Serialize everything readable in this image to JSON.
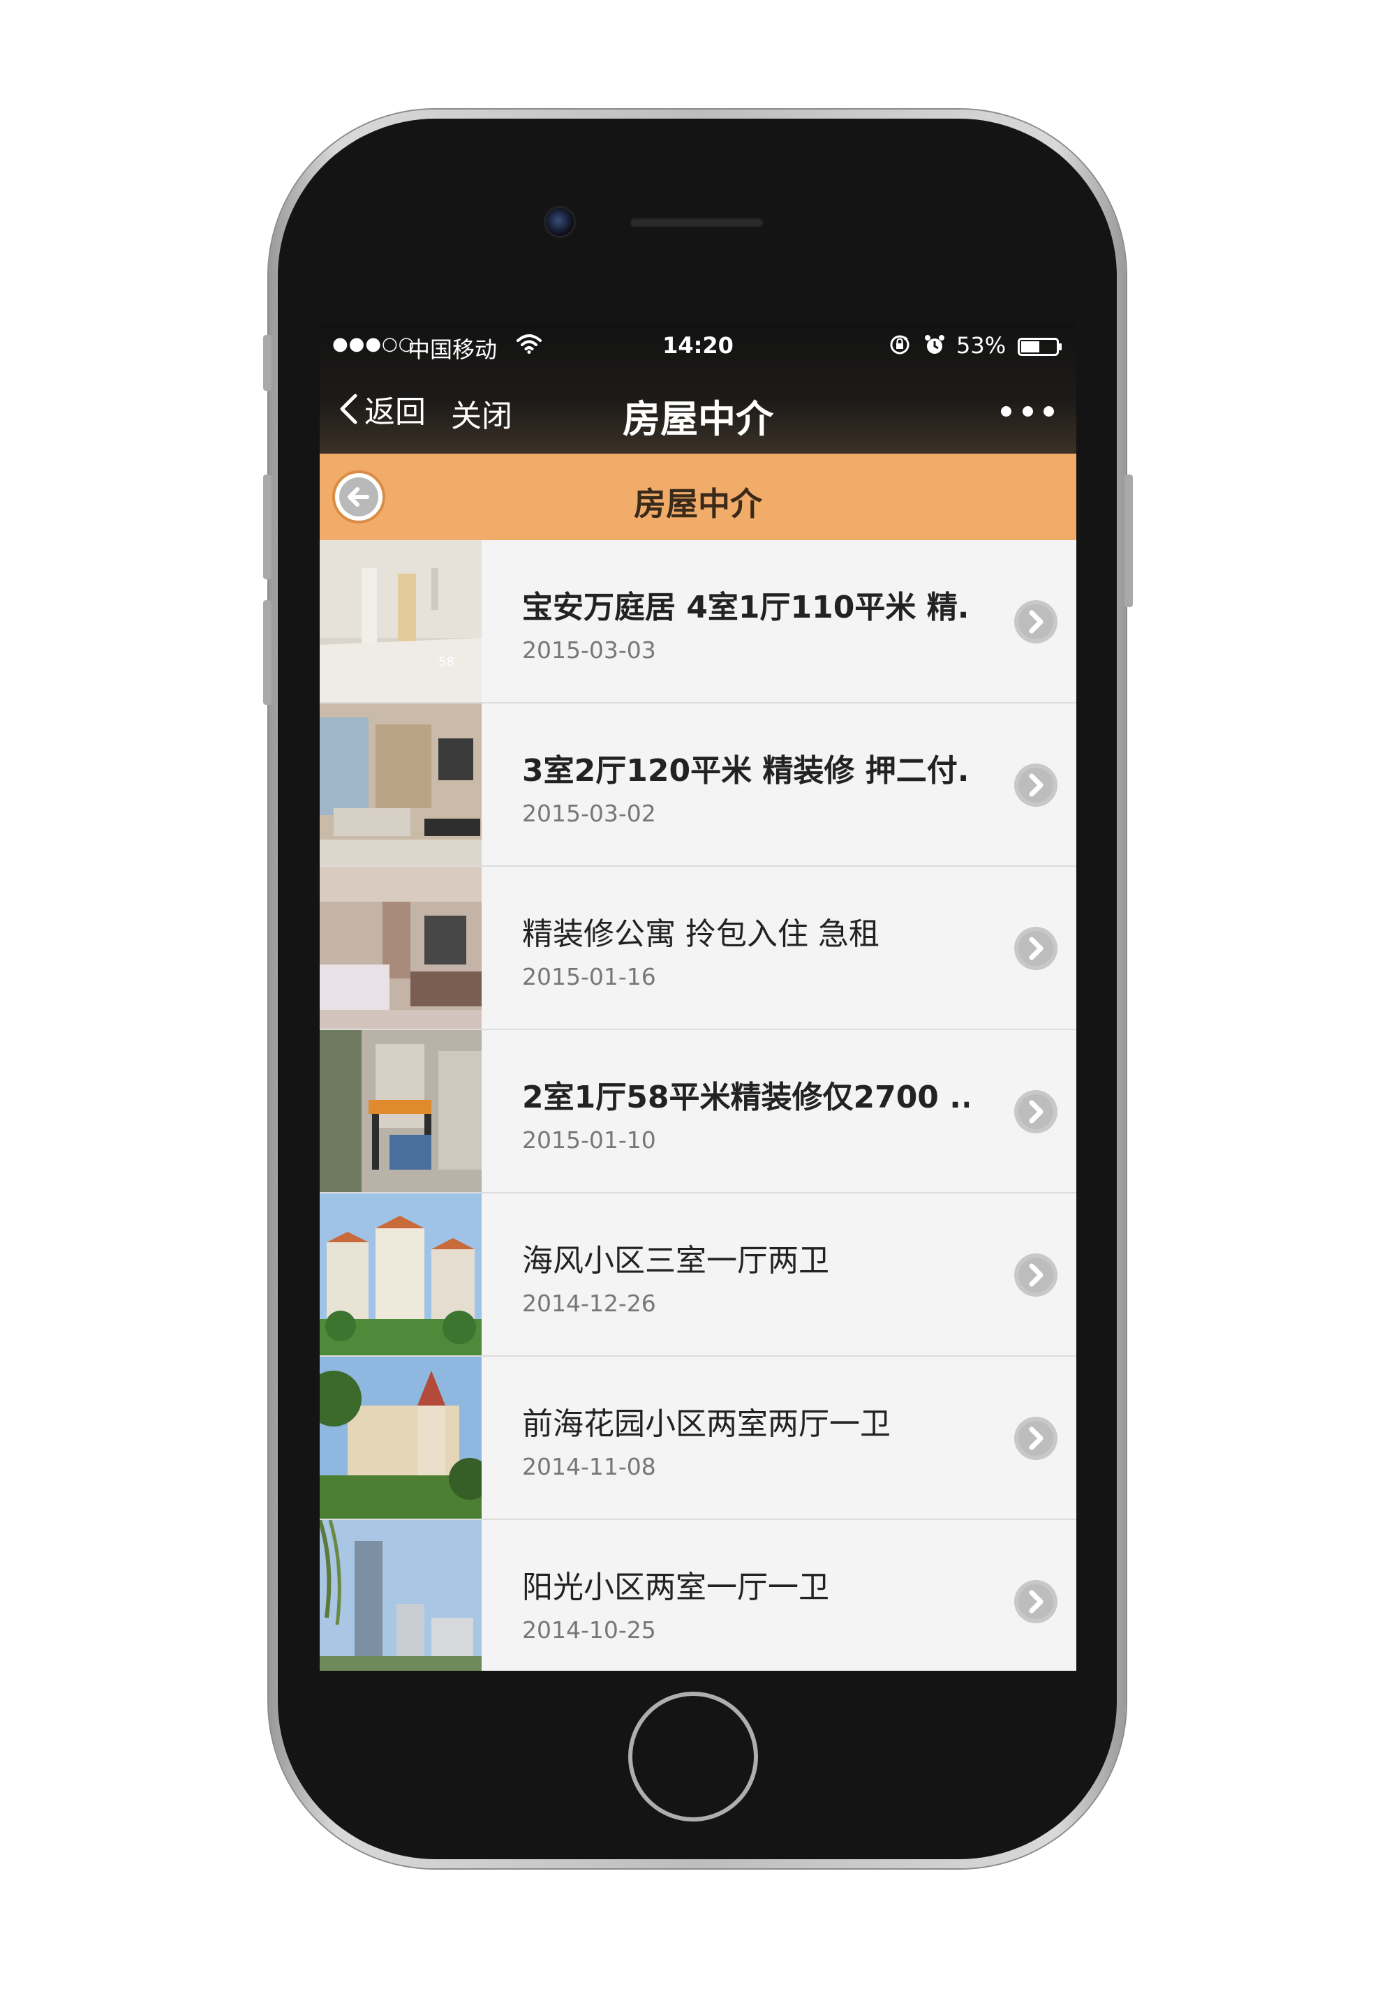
{
  "status_bar": {
    "signal": "●●●○○",
    "carrier": "中国移动",
    "time": "14:20",
    "battery_percent": "53%",
    "battery_level": 0.53,
    "icons": [
      "wifi-icon",
      "rotation-lock-icon",
      "alarm-icon",
      "battery-icon"
    ]
  },
  "navbar": {
    "back_label": "返回",
    "close_label": "关闭",
    "title": "房屋中介",
    "more_icon": "more-dots-icon"
  },
  "page_header": {
    "title": "房屋中介",
    "back_icon": "circle-back-arrow-icon"
  },
  "listings": [
    {
      "title": "宝安万庭居 4室1厅110平米 精...",
      "date": "2015-03-03",
      "bold": true
    },
    {
      "title": "3室2厅120平米 精装修 押二付...",
      "date": "2015-03-02",
      "bold": true
    },
    {
      "title": "精装修公寓 拎包入住 急租",
      "date": "2015-01-16",
      "bold": false
    },
    {
      "title": "2室1厅58平米精装修仅2700 ...",
      "date": "2015-01-10",
      "bold": true
    },
    {
      "title": "海风小区三室一厅两卫",
      "date": "2014-12-26",
      "bold": false
    },
    {
      "title": "前海花园小区两室两厅一卫",
      "date": "2014-11-08",
      "bold": false
    },
    {
      "title": "阳光小区两室一厅一卫",
      "date": "2014-10-25",
      "bold": false
    }
  ],
  "colors": {
    "header_orange": "#f2ac6a",
    "list_bg": "#f4f4f4",
    "phone_bezel": "#141414"
  }
}
